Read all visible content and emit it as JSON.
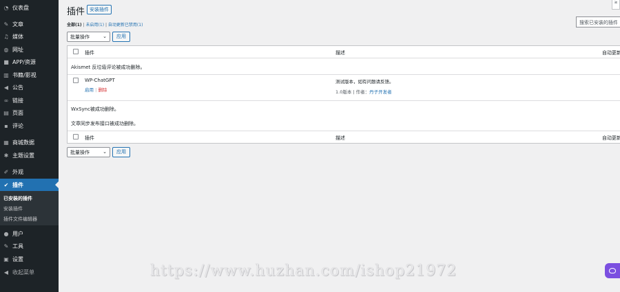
{
  "sidebar": {
    "items": [
      {
        "label": "仪表盘",
        "icon": "dashboard-icon"
      },
      {
        "label": "文章",
        "icon": "pin-icon"
      },
      {
        "label": "媒体",
        "icon": "media-icon"
      },
      {
        "label": "网址",
        "icon": "globe-icon"
      },
      {
        "label": "APP/资源",
        "icon": "box-icon"
      },
      {
        "label": "书籍/影视",
        "icon": "book-icon"
      },
      {
        "label": "公告",
        "icon": "megaphone-icon"
      },
      {
        "label": "链接",
        "icon": "link-icon"
      },
      {
        "label": "页面",
        "icon": "page-icon"
      },
      {
        "label": "评论",
        "icon": "comment-icon"
      },
      {
        "label": "商城数据",
        "icon": "table-icon"
      },
      {
        "label": "主题设置",
        "icon": "gear-icon"
      },
      {
        "label": "外观",
        "icon": "brush-icon"
      },
      {
        "label": "插件",
        "icon": "plugin-icon"
      },
      {
        "label": "用户",
        "icon": "user-icon"
      },
      {
        "label": "工具",
        "icon": "wrench-icon"
      },
      {
        "label": "设置",
        "icon": "settings-icon"
      },
      {
        "label": "收起菜单",
        "icon": "collapse-icon"
      }
    ],
    "submenu": [
      "已安装的插件",
      "安装插件",
      "插件文件编辑器"
    ]
  },
  "header": {
    "title": "插件",
    "add_new": "安装插件",
    "top_right": "≥"
  },
  "filters": {
    "all": "全部",
    "all_count": "(1)",
    "sep1": " | ",
    "inactive": "未启用",
    "inactive_count": "(1)",
    "sep2": " | ",
    "auto_update_disabled": "自动更新已禁用",
    "auto_update_count": "(1)"
  },
  "search": {
    "placeholder": "搜索已安装的插件"
  },
  "bulk": {
    "label": "批量操作",
    "apply": "应用"
  },
  "table": {
    "columns": {
      "plugin": "插件",
      "description": "描述",
      "auto_update": "自动更新"
    },
    "notices": {
      "akismet": "Akismet 反垃圾评论被成功删除。",
      "wxsync": "WxSync被成功删除。",
      "publish": "文章同步发布接口被成功删除。"
    },
    "plugin": {
      "name": "WP-ChatGPT",
      "activate": "启用",
      "action_sep": " | ",
      "delete": "删除",
      "description": "测试版本，如有问题请反馈。",
      "meta_prefix": "1.0版本 | 作者：",
      "author": "丹子开发者"
    }
  },
  "watermark": "https://www.huzhan.com/ishop21972",
  "colors": {
    "sidebar": "#1d2327",
    "accent": "#2271b1",
    "delete": "#d63638",
    "float_button": "#7b4fe0"
  }
}
